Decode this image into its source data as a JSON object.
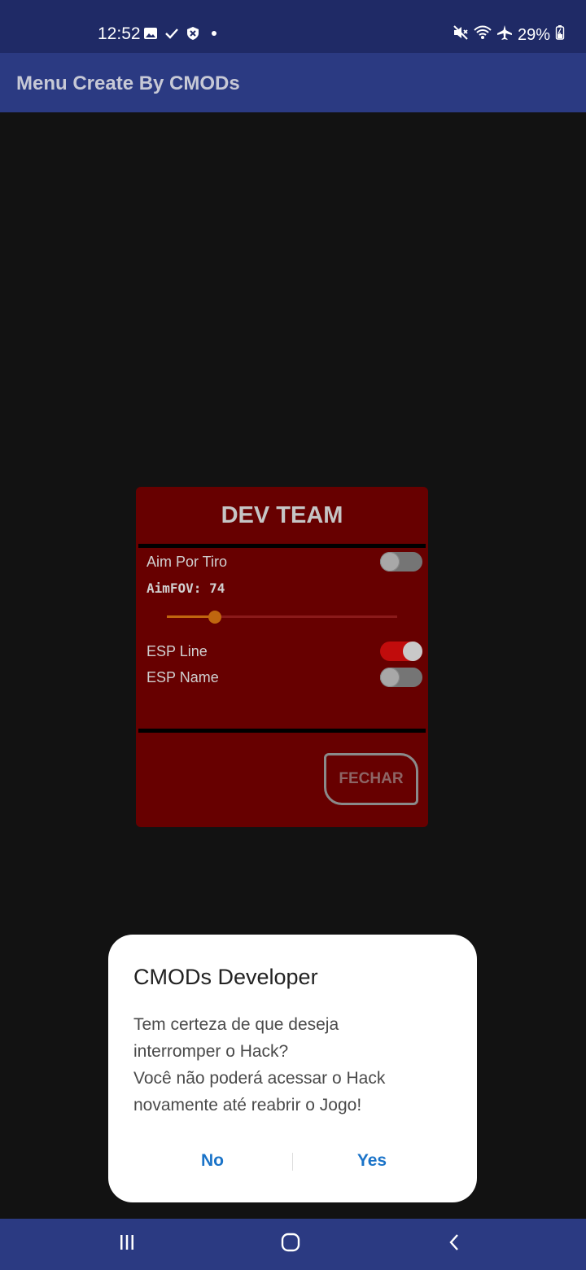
{
  "status_bar": {
    "time": "12:52",
    "battery": "29%",
    "left_icons": [
      "image-icon",
      "check-icon",
      "shield-icon",
      "dot-icon"
    ],
    "right_icons": [
      "mute-icon",
      "wifi-icon",
      "airplane-icon",
      "battery-icon"
    ]
  },
  "app_bar": {
    "title": "Menu Create By CMODs"
  },
  "panel": {
    "title": "DEV TEAM",
    "background": "#670000",
    "toggles": [
      {
        "label": "Aim Por Tiro",
        "on": false
      },
      {
        "label": "ESP Line",
        "on": true
      },
      {
        "label": "ESP Name",
        "on": false
      }
    ],
    "fov": {
      "label": "AimFOV: 74",
      "fraction": 0.21
    },
    "close_button": "FECHAR"
  },
  "dialog": {
    "title": "CMODs Developer",
    "message": "Tem certeza de que deseja\ninterromper o Hack?\nVocê não poderá acessar o Hack\nnovamente até reabrir o Jogo!",
    "negative": "No",
    "positive": "Yes",
    "accent": "#1a73c8"
  },
  "nav_bar": {
    "buttons": [
      "recents-icon",
      "home-icon",
      "back-icon"
    ]
  }
}
